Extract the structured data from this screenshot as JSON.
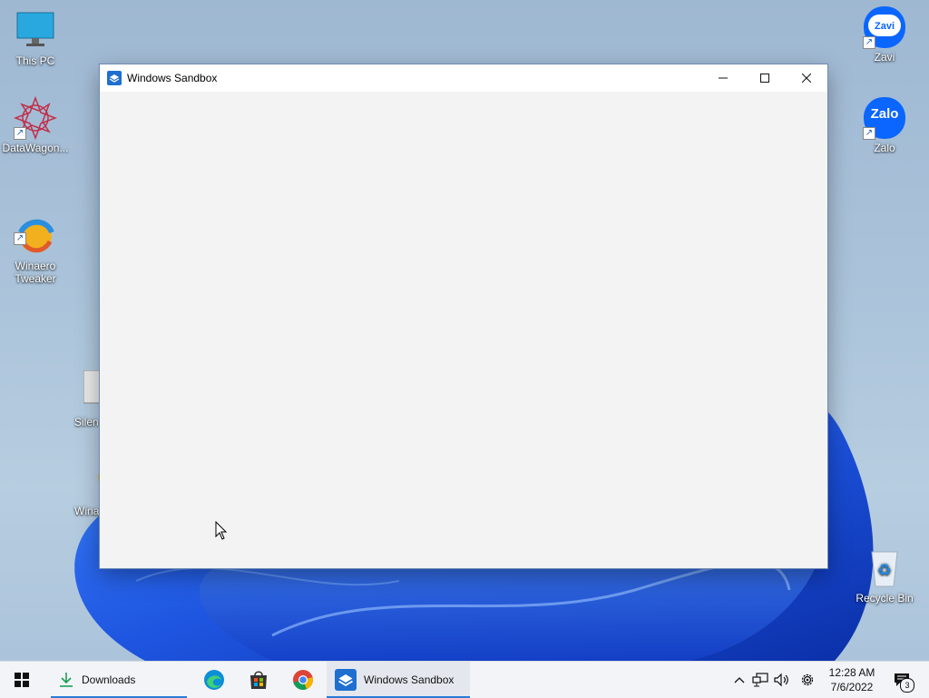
{
  "desktop": {
    "icons_left": [
      {
        "label": "This PC"
      },
      {
        "label": "DataWagon..."
      },
      {
        "label": "Winaero\nTweaker"
      },
      {
        "label": "Silen"
      },
      {
        "label": "Wina"
      }
    ],
    "icons_right": [
      {
        "label": "Zavi",
        "badge_text": "Zavi"
      },
      {
        "label": "Zalo",
        "badge_text": "Zalo"
      },
      {
        "label": "Recycle Bin"
      }
    ]
  },
  "window": {
    "title": "Windows Sandbox"
  },
  "taskbar": {
    "downloads_label": "Downloads",
    "sandbox_label": "Windows Sandbox",
    "clock_time": "12:28 AM",
    "clock_date": "7/6/2022",
    "notification_count": "3"
  },
  "colors": {
    "accent": "#2b7bd6",
    "window_bg": "#f3f3f3",
    "titlebar_bg": "#ffffff",
    "taskbar_bg": "#f2f4f7"
  }
}
